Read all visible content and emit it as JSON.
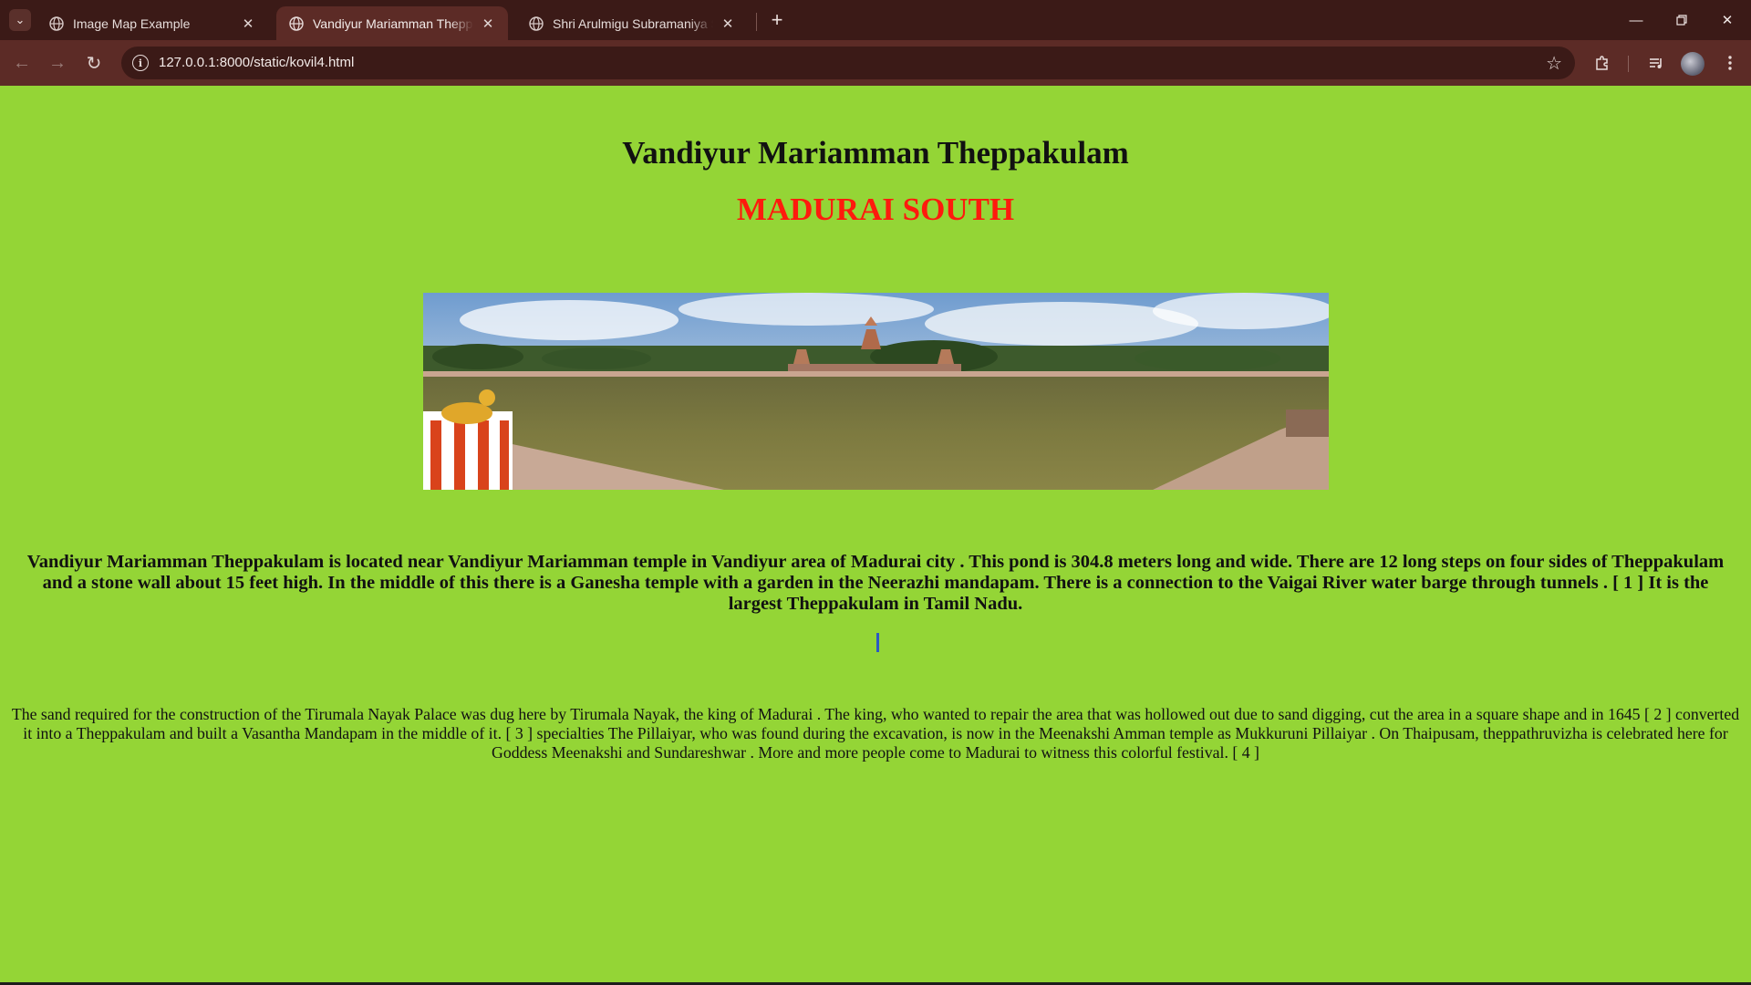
{
  "browser": {
    "tabs": [
      {
        "title": "Image Map Example",
        "active": false
      },
      {
        "title": "Vandiyur Mariamman Theppakulam",
        "active": true
      },
      {
        "title": "Shri Arulmigu Subramaniya Swamy Temple",
        "active": false
      }
    ],
    "url": "127.0.0.1:8000/static/kovil4.html",
    "icons": {
      "tab_search": "chevron-down-icon",
      "new_tab": "plus-icon",
      "back": "arrow-left-icon",
      "forward": "arrow-right-icon",
      "reload": "reload-icon",
      "site_info": "info-icon",
      "bookmark": "star-icon",
      "extensions": "puzzle-icon",
      "media": "media-queue-icon",
      "profile": "avatar-icon",
      "menu": "kebab-menu-icon",
      "minimize": "minimize-icon",
      "restore": "restore-icon",
      "close": "close-icon"
    },
    "colors": {
      "frame": "#3b1a17",
      "toolbar": "#5c2b26"
    }
  },
  "page": {
    "heading": "Vandiyur Mariamman Theppakulam",
    "subheading": "MADURAI SOUTH",
    "image_alt": "",
    "paragraph1": "Vandiyur Mariamman Theppakulam is located near Vandiyur Mariamman temple in Vandiyur area of Madurai city . This pond is 304.8 meters long and wide. There are 12 long steps on four sides of Theppakulam and a stone wall about 15 feet high. In the middle of this there is a Ganesha temple with a garden in the Neerazhi mandapam. There is a connection to the Vaigai River water barge through tunnels . [ 1 ] It is the largest Theppakulam in Tamil Nadu.",
    "paragraph2": "The sand required for the construction of the Tirumala Nayak Palace was dug here by Tirumala Nayak, the king of Madurai . The king, who wanted to repair the area that was hollowed out due to sand digging, cut the area in a square shape and in 1645 [ 2 ] converted it into a Theppakulam and built a Vasantha Mandapam in the middle of it. [ 3 ] specialties The Pillaiyar, who was found during the excavation, is now in the Meenakshi Amman temple as Mukkuruni Pillaiyar . On Thaipusam, theppathruvizha is celebrated here for Goddess Meenakshi and Sundareshwar . More and more people come to Madurai to witness this colorful festival. [ 4 ]",
    "colors": {
      "background": "#94d536",
      "heading": "#111111",
      "subheading": "#ff1a0d"
    }
  }
}
